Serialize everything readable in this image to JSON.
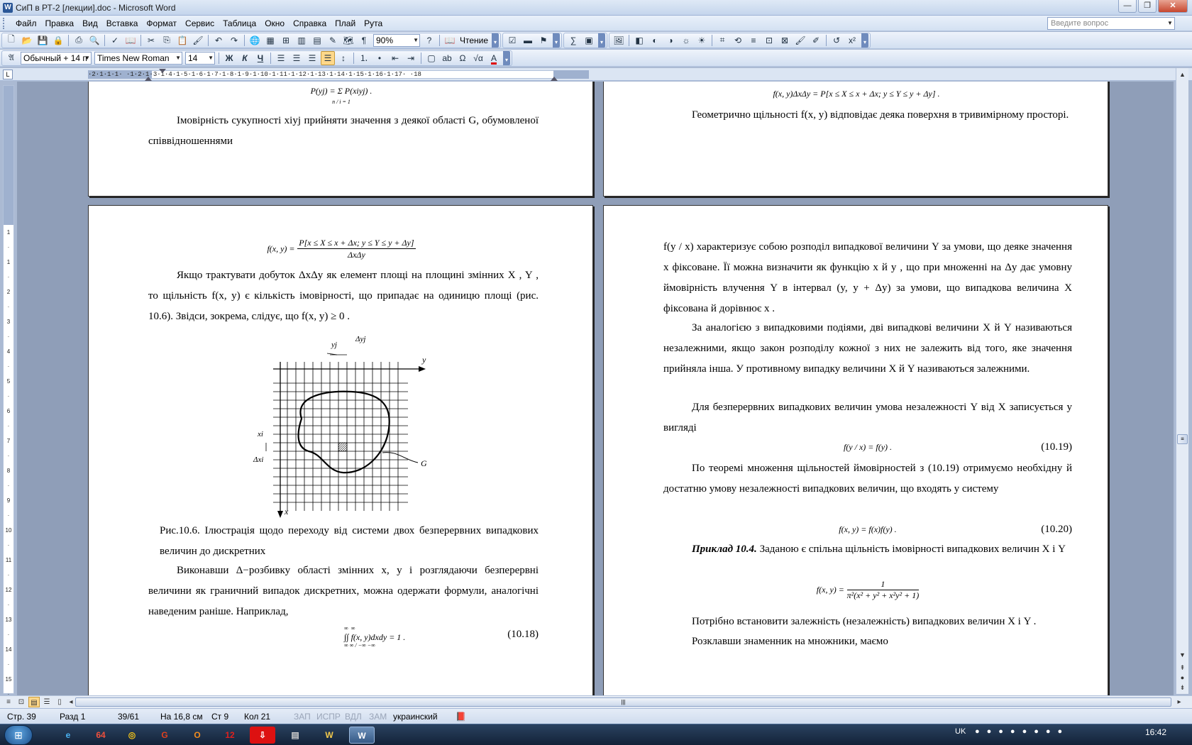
{
  "window": {
    "title": "СиП в РТ-2 [лекции].doc - Microsoft Word",
    "app_icon": "W",
    "controls": {
      "minimize": "—",
      "restore": "❐",
      "close": "✕"
    }
  },
  "menu": {
    "items": [
      "Файл",
      "Правка",
      "Вид",
      "Вставка",
      "Формат",
      "Сервис",
      "Таблица",
      "Окно",
      "Справка",
      "Плай",
      "Рута"
    ],
    "help_placeholder": "Введите вопрос"
  },
  "toolbar": {
    "zoom": "90%",
    "reading_label": "Чтение",
    "style": "Обычный + 14 п",
    "font": "Times New Roman",
    "size": "14",
    "bold": "Ж",
    "italic": "К",
    "underline": "Ч"
  },
  "ruler": {
    "numbers": "·2·1·1·1·  ·1·2·1·3·1·4·1·5·1·6·1·7·1·8·1·9·1·10·1·11·1·12·1·13·1·14·1·15·1·16·1·17· ·18"
  },
  "vruler": {
    "numbers": [
      "1",
      "·",
      "1",
      "·",
      "2",
      "·",
      "3",
      "·",
      "4",
      "·",
      "5",
      "·",
      "6",
      "·",
      "7",
      "·",
      "8",
      "·",
      "9",
      "·",
      "10",
      "·",
      "11",
      "·",
      "12",
      "·",
      "13",
      "·",
      "14",
      "·",
      "15",
      "·",
      "16",
      "·",
      "17",
      "·",
      "18"
    ]
  },
  "pages": {
    "top_left": {
      "formula": "P(yj) = Σ P(xiyj) .",
      "formula_limits": "n / i = 1",
      "para": "Імовірність сукупності xiyj прийняти значення з деякої області G, обумовленої співвідношеннями"
    },
    "top_right": {
      "formula": "f(x, y)ΔxΔy = P[x ≤ X ≤ x + Δx;   y ≤ Y ≤ y + Δy] .",
      "para": "Геометрично щільності f(x, y) відповідає деяка поверхня в тривимірному просторі."
    },
    "bottom_left": {
      "formula_lhs": "f(x, y) =",
      "formula_num": "P[x ≤ X ≤ x + Δx;   y ≤ Y ≤ y + Δy]",
      "formula_den": "ΔxΔy",
      "para1": "Якщо трактувати добуток ΔxΔy як елемент площі на площині змінних X , Y , то щільність f(x, y) є кількість імовірності, що припадає на одиницю площі (рис. 10.6). Звідси, зокрема, слідує, що f(x, y) ≥ 0 .",
      "fig_labels": {
        "y_axis": "y",
        "x_axis": "x",
        "yj": "yj",
        "dyj": "Δyj",
        "xi": "xi",
        "dxi": "Δxi",
        "region": "G"
      },
      "caption": "Рис.10.6. Ілюстрація щодо переходу від системи двох безперервних випадкових величин до дискретних",
      "para2": "Виконавши Δ−розбивку області змінних x, y і розглядаючи безперервні величини як граничний випадок дискретних, можна одержати формули, аналогічні наведеним раніше. Наприклад,",
      "formula2": "∫∫ f(x, y)dxdy = 1 .",
      "formula2_limits": "∞ ∞ / −∞ −∞",
      "eqnum": "(10.18)"
    },
    "bottom_right": {
      "para1": "f(y / x) характеризує собою розподіл випадкової величини Y за умови, що деяке значення x фіксоване. Її можна визначити як функцію x й y , що при множенні на Δy дає умовну ймовірність влучення Y в інтервал (y, y + Δy) за умови, що випадкова величина X фіксована й дорівнює x .",
      "para2": "За аналогією з випадковими подіями, дві випадкові величини X й Y називаються незалежними, якщо закон розподілу кожної з них не залежить від того, яке значення прийняла інша. У противному випадку величини X й Y називаються залежними.",
      "para3": "Для безперервних випадкових величин умова незалежності Y від X записується у вигляді",
      "formula1": "f(y / x) = f(y) .",
      "eqnum1": "(10.19)",
      "para4": "По теоремі множення щільностей ймовірностей з (10.19) отримуємо необхідну й достатню умову незалежності випадкових величин, що входять у систему",
      "formula2": "f(x, y) = f(x)f(y) .",
      "eqnum2": "(10.20)",
      "example_title": "Приклад 10.4.",
      "example_text": "Заданою є спільна щільність імовірності випадкових величин X і Y",
      "formula3_lhs": "f(x, y) =",
      "formula3_num": "1",
      "formula3_den": "π²(x² + y² + x²y² + 1)",
      "para5": "Потрібно встановити залежність (незалежність) випадкових величин X і Y .",
      "para6": "Розклавши знаменник на множники, маємо"
    }
  },
  "status": {
    "page": "Стр. 39",
    "section": "Разд 1",
    "pages": "39/61",
    "position": "На 16,8 см",
    "line": "Ст 9",
    "column": "Кол 21",
    "rec": "ЗАП",
    "trk": "ИСПР",
    "ext": "ВДЛ",
    "ovr": "ЗАМ",
    "language": "украинский"
  },
  "taskbar": {
    "apps": [
      "e",
      "64",
      "◎",
      "G",
      "O",
      "12",
      "⇩",
      "▤",
      "W"
    ],
    "tray_lang": "UK",
    "clock": "16:42"
  }
}
